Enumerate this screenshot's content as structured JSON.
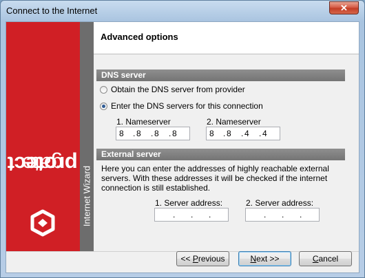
{
  "window": {
    "title": "Connect to the Internet",
    "close_glyph": "✕"
  },
  "sidebar": {
    "brand_light": "gate",
    "brand_bold": "protect",
    "wizard_label": "Internet Wizard",
    "brand_color": "#d01f25"
  },
  "header": {
    "title": "Advanced options"
  },
  "dns": {
    "section_title": "DNS server",
    "options": [
      {
        "label": "Obtain the DNS server from provider",
        "checked": false
      },
      {
        "label": "Enter the DNS servers for this connection",
        "checked": true
      }
    ],
    "nameserver1_label": "1. Nameserver",
    "nameserver1_octets": [
      "8",
      "8",
      "8",
      "8"
    ],
    "nameserver2_label": "2. Nameserver",
    "nameserver2_octets": [
      "8",
      "8",
      "4",
      "4"
    ]
  },
  "external": {
    "section_title": "External server",
    "description": "Here you can enter the addresses of highly reachable external servers. With these addresses it will be checked if the internet connection is still established.",
    "server1_label": "1. Server address:",
    "server2_label": "2. Server address:"
  },
  "buttons": {
    "prev_prefix": "<< ",
    "prev_mnemonic": "P",
    "prev_rest": "revious",
    "next_mnemonic": "N",
    "next_rest": "ext >>",
    "cancel_mnemonic": "C",
    "cancel_rest": "ancel"
  }
}
